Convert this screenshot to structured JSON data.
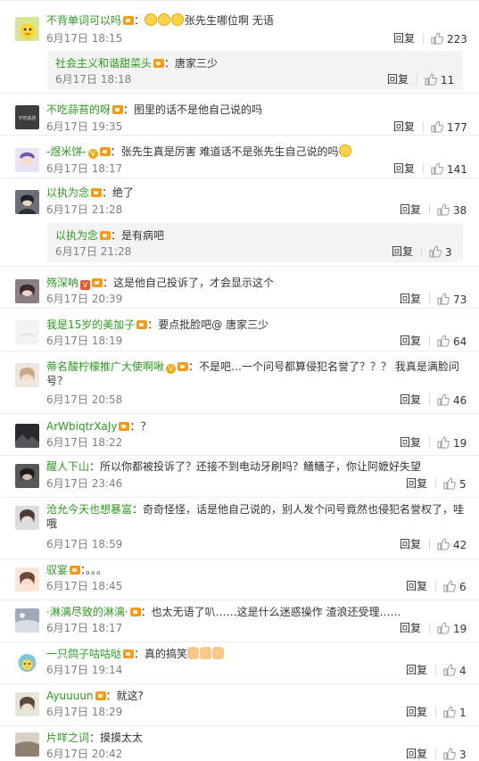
{
  "reply_label": "回复",
  "comments": [
    {
      "user": "不背单词可以吗",
      "text": "张先生哪位啊 无语",
      "time": "6月17日 18:15",
      "likes": "223",
      "extra": "emoji3"
    },
    {
      "user": "社会主义和谐甜菜头",
      "text": "唐家三少",
      "time": "6月17日 18:18",
      "likes": "11",
      "sub": true
    },
    {
      "user": "不吃蒜苔的呀",
      "text": "图里的话不是他自己说的吗",
      "time": "6月17日 19:35",
      "likes": "177"
    },
    {
      "user": "-煜米饼-",
      "text": "张先生真是厉害 难道话不是张先生自己说的吗",
      "time": "6月17日 18:17",
      "likes": "141"
    },
    {
      "user": "以执为念",
      "text": "绝了",
      "time": "6月17日 21:28",
      "likes": "38"
    },
    {
      "user": "以执为念",
      "text": "是有病吧",
      "time": "6月17日 21:28",
      "likes": "3",
      "sub": true
    },
    {
      "user": "殇深呐",
      "text": "这是他自己投诉了，才会显示这个",
      "time": "6月17日 20:39",
      "likes": "73"
    },
    {
      "user": "我是15岁的美加子",
      "text": "要点批脸吧@ 唐家三少",
      "time": "6月17日 18:19",
      "likes": "64"
    },
    {
      "user": "蒂名酸柠檬推广大使啊啾",
      "text": "不是吧…一个问号都算侵犯名誉了？？？ 我真是满脸问号？",
      "time": "6月17日 20:58",
      "likes": "46"
    },
    {
      "user": "ArWbiqtrXaJy",
      "text": "？",
      "time": "6月17日 18:22",
      "likes": "19"
    },
    {
      "user": "醒人下山",
      "text": "所以你都被投诉了？还接不到电动牙刷吗？鳝鳝子，你让阿嬷好失望",
      "time": "6月17日 23:46",
      "likes": "5"
    },
    {
      "user": "沧允今天也想暴富",
      "text": "奇奇怪怪，话是他自己说的，别人发个问号竟然也侵犯名誉权了，哇哦",
      "time": "6月17日 18:59",
      "likes": "42"
    },
    {
      "user": "驭宴",
      "text": "。。。",
      "time": "6月17日 18:45",
      "likes": "6"
    },
    {
      "user": "·淋漓尽致的淋漓·",
      "text": "也太无语了叭……这是什么迷惑操作 渣浪还受理……",
      "time": "6月17日 18:17",
      "likes": "19"
    },
    {
      "user": "一只鸽子咕咕哒",
      "text": "真的搞笑",
      "time": "6月17日 19:14",
      "likes": "4"
    },
    {
      "user": "Ayuuuun",
      "text": "就这?",
      "time": "6月17日 18:29",
      "likes": "1"
    },
    {
      "user": "片咩之词",
      "text": "摸摸太太",
      "time": "6月17日 20:42",
      "likes": "3"
    }
  ]
}
